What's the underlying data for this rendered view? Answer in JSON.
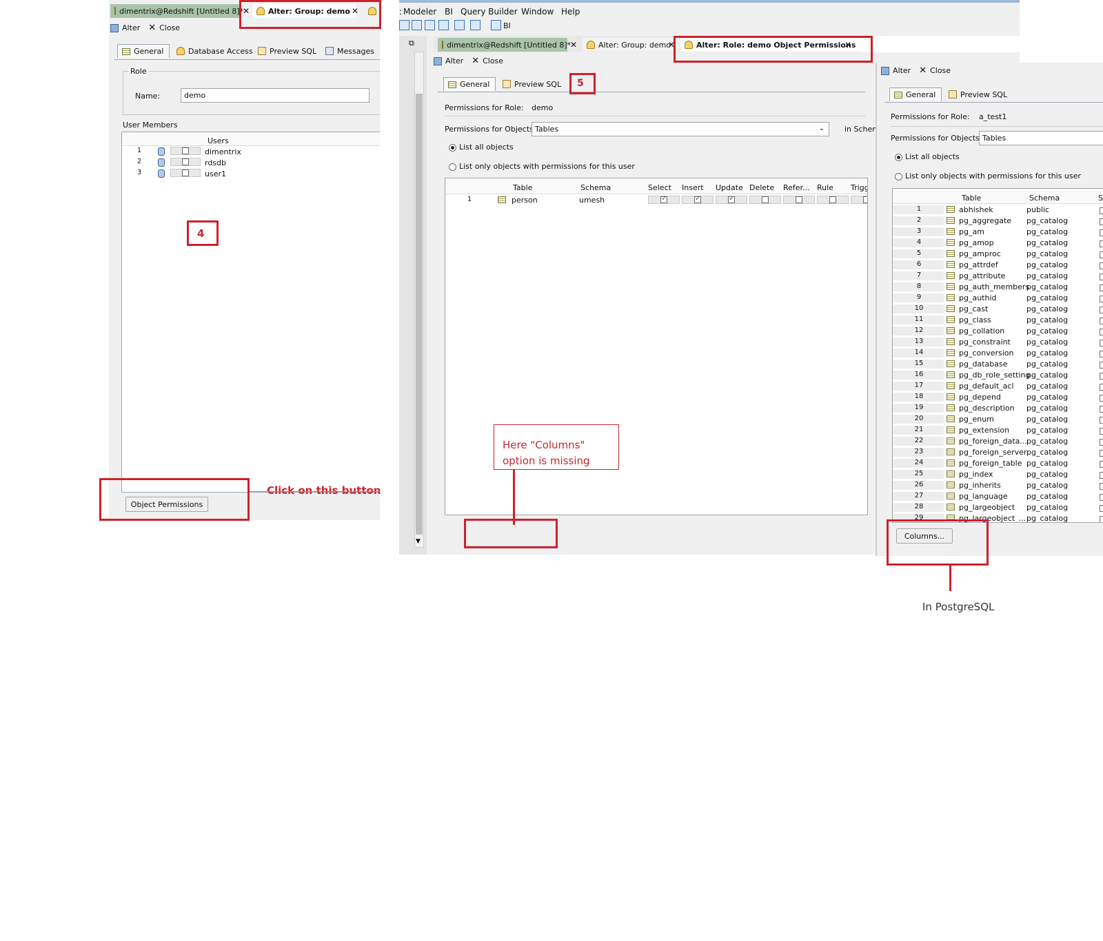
{
  "left": {
    "tabs": [
      {
        "label": "dimentrix@Redshift [Untitled 8]*",
        "close": "✕"
      },
      {
        "label": "Alter: Group: demo",
        "close": "✕"
      }
    ],
    "toolbar": {
      "alter": "Alter",
      "close": "Close"
    },
    "subtabs": [
      "General",
      "Database Access",
      "Preview SQL",
      "Messages"
    ],
    "role_group": "Role",
    "name_label": "Name:",
    "name_value": "demo",
    "user_members_label": "User Members",
    "users_header": "Users",
    "users": [
      {
        "num": "1",
        "name": "dimentrix"
      },
      {
        "num": "2",
        "name": "rdsdb"
      },
      {
        "num": "3",
        "name": "user1"
      }
    ],
    "object_permissions_button": "Object Permissions",
    "step_number": "4",
    "click_note": "Click on this button"
  },
  "middle": {
    "menu": [
      "Modeler",
      "BI",
      "Query Builder",
      "Window",
      "Help"
    ],
    "menu_prefix": ":",
    "bi_label": "BI",
    "tabs": [
      {
        "label": "dimentrix@Redshift [Untitled 8]*",
        "close": "✕"
      },
      {
        "label": "Alter: Group: demo",
        "close": "✕"
      },
      {
        "label": "Alter: Role: demo Object Permissions",
        "close": "✕"
      }
    ],
    "toolbar": {
      "alter": "Alter",
      "close": "Close"
    },
    "subtabs": [
      "General",
      "Preview SQL"
    ],
    "step_number": "5",
    "perm_role_label": "Permissions for Role:",
    "perm_role_value": "demo",
    "perm_obj_label": "Permissions for Objects:",
    "perm_obj_value": "Tables",
    "in_schema_label": "in Schem",
    "radio_all": "List all objects",
    "radio_only": "List only objects with permissions for this user",
    "columns": [
      "Table",
      "Schema",
      "Select",
      "Insert",
      "Update",
      "Delete",
      "Refer...",
      "Rule",
      "Trigg"
    ],
    "rows": [
      {
        "num": "1",
        "table": "person",
        "schema": "umesh",
        "perms": [
          true,
          true,
          true,
          false,
          false,
          false,
          false
        ]
      }
    ],
    "missing_note_line1": "Here \"Columns\"",
    "missing_note_line2": "option is missing"
  },
  "right": {
    "toolbar": {
      "alter": "Alter",
      "close": "Close"
    },
    "subtabs": [
      "General",
      "Preview SQL"
    ],
    "perm_role_label": "Permissions for Role:",
    "perm_role_value": "a_test1",
    "perm_obj_label": "Permissions for Objects:",
    "perm_obj_value": "Tables",
    "radio_all": "List all objects",
    "radio_only": "List only objects with permissions for this user",
    "columns": [
      "Table",
      "Schema",
      "S"
    ],
    "rows": [
      {
        "num": "1",
        "table": "abhishek",
        "schema": "public"
      },
      {
        "num": "2",
        "table": "pg_aggregate",
        "schema": "pg_catalog"
      },
      {
        "num": "3",
        "table": "pg_am",
        "schema": "pg_catalog"
      },
      {
        "num": "4",
        "table": "pg_amop",
        "schema": "pg_catalog"
      },
      {
        "num": "5",
        "table": "pg_amproc",
        "schema": "pg_catalog"
      },
      {
        "num": "6",
        "table": "pg_attrdef",
        "schema": "pg_catalog"
      },
      {
        "num": "7",
        "table": "pg_attribute",
        "schema": "pg_catalog"
      },
      {
        "num": "8",
        "table": "pg_auth_members",
        "schema": "pg_catalog"
      },
      {
        "num": "9",
        "table": "pg_authid",
        "schema": "pg_catalog"
      },
      {
        "num": "10",
        "table": "pg_cast",
        "schema": "pg_catalog"
      },
      {
        "num": "11",
        "table": "pg_class",
        "schema": "pg_catalog"
      },
      {
        "num": "12",
        "table": "pg_collation",
        "schema": "pg_catalog"
      },
      {
        "num": "13",
        "table": "pg_constraint",
        "schema": "pg_catalog"
      },
      {
        "num": "14",
        "table": "pg_conversion",
        "schema": "pg_catalog"
      },
      {
        "num": "15",
        "table": "pg_database",
        "schema": "pg_catalog"
      },
      {
        "num": "16",
        "table": "pg_db_role_setting",
        "schema": "pg_catalog"
      },
      {
        "num": "17",
        "table": "pg_default_acl",
        "schema": "pg_catalog"
      },
      {
        "num": "18",
        "table": "pg_depend",
        "schema": "pg_catalog"
      },
      {
        "num": "19",
        "table": "pg_description",
        "schema": "pg_catalog"
      },
      {
        "num": "20",
        "table": "pg_enum",
        "schema": "pg_catalog"
      },
      {
        "num": "21",
        "table": "pg_extension",
        "schema": "pg_catalog"
      },
      {
        "num": "22",
        "table": "pg_foreign_data...",
        "schema": "pg_catalog"
      },
      {
        "num": "23",
        "table": "pg_foreign_server",
        "schema": "pg_catalog"
      },
      {
        "num": "24",
        "table": "pg_foreign_table",
        "schema": "pg_catalog"
      },
      {
        "num": "25",
        "table": "pg_index",
        "schema": "pg_catalog"
      },
      {
        "num": "26",
        "table": "pg_inherits",
        "schema": "pg_catalog"
      },
      {
        "num": "27",
        "table": "pg_language",
        "schema": "pg_catalog"
      },
      {
        "num": "28",
        "table": "pg_largeobject",
        "schema": "pg_catalog"
      },
      {
        "num": "29",
        "table": "pg_largeobject_...",
        "schema": "pg_catalog"
      }
    ],
    "columns_button": "Columns...",
    "note": "In PostgreSQL"
  },
  "colors": {
    "annotation_red": "#d0202a",
    "active_tab_green": "#a9c4a8",
    "panel_bg": "#f0f0f0"
  }
}
